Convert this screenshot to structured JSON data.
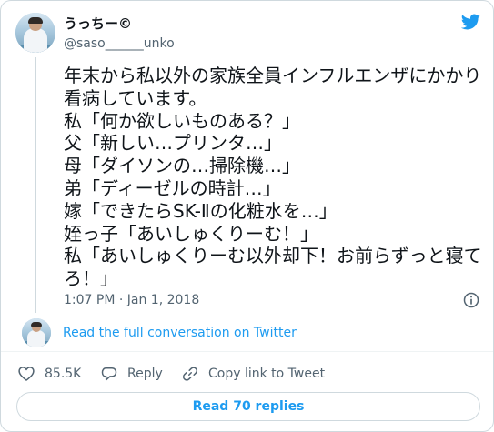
{
  "author": {
    "display_name": "うっちー©",
    "handle": "@saso______unko"
  },
  "tweet": {
    "lines": [
      "年末から私以外の家族全員インフルエンザにかかり",
      "看病しています。",
      "私「何か欲しいものある？」",
      "父「新しい…プリンタ…」",
      "母「ダイソンの…掃除機…」",
      "弟「ディーゼルの時計…」",
      "嫁「できたらSK-Ⅱの化粧水を…」",
      "姪っ子「あいしゅくりーむ！」",
      "私「あいしゅくりーむ以外却下！お前らずっと寝て",
      "ろ！」"
    ],
    "timestamp": "1:07 PM · Jan 1, 2018"
  },
  "conversation": {
    "link_label": "Read the full conversation on Twitter"
  },
  "actions": {
    "likes": "85.5K",
    "reply_label": "Reply",
    "copy_label": "Copy link to Tweet"
  },
  "read_replies_label": "Read 70 replies",
  "colors": {
    "brand": "#1d9bf0",
    "like": "#f91880",
    "text": "#0f1419",
    "muted": "#536471",
    "border": "#cfd9de"
  },
  "icons": [
    "twitter-bird-icon",
    "info-icon",
    "heart-icon",
    "reply-icon",
    "link-icon"
  ]
}
